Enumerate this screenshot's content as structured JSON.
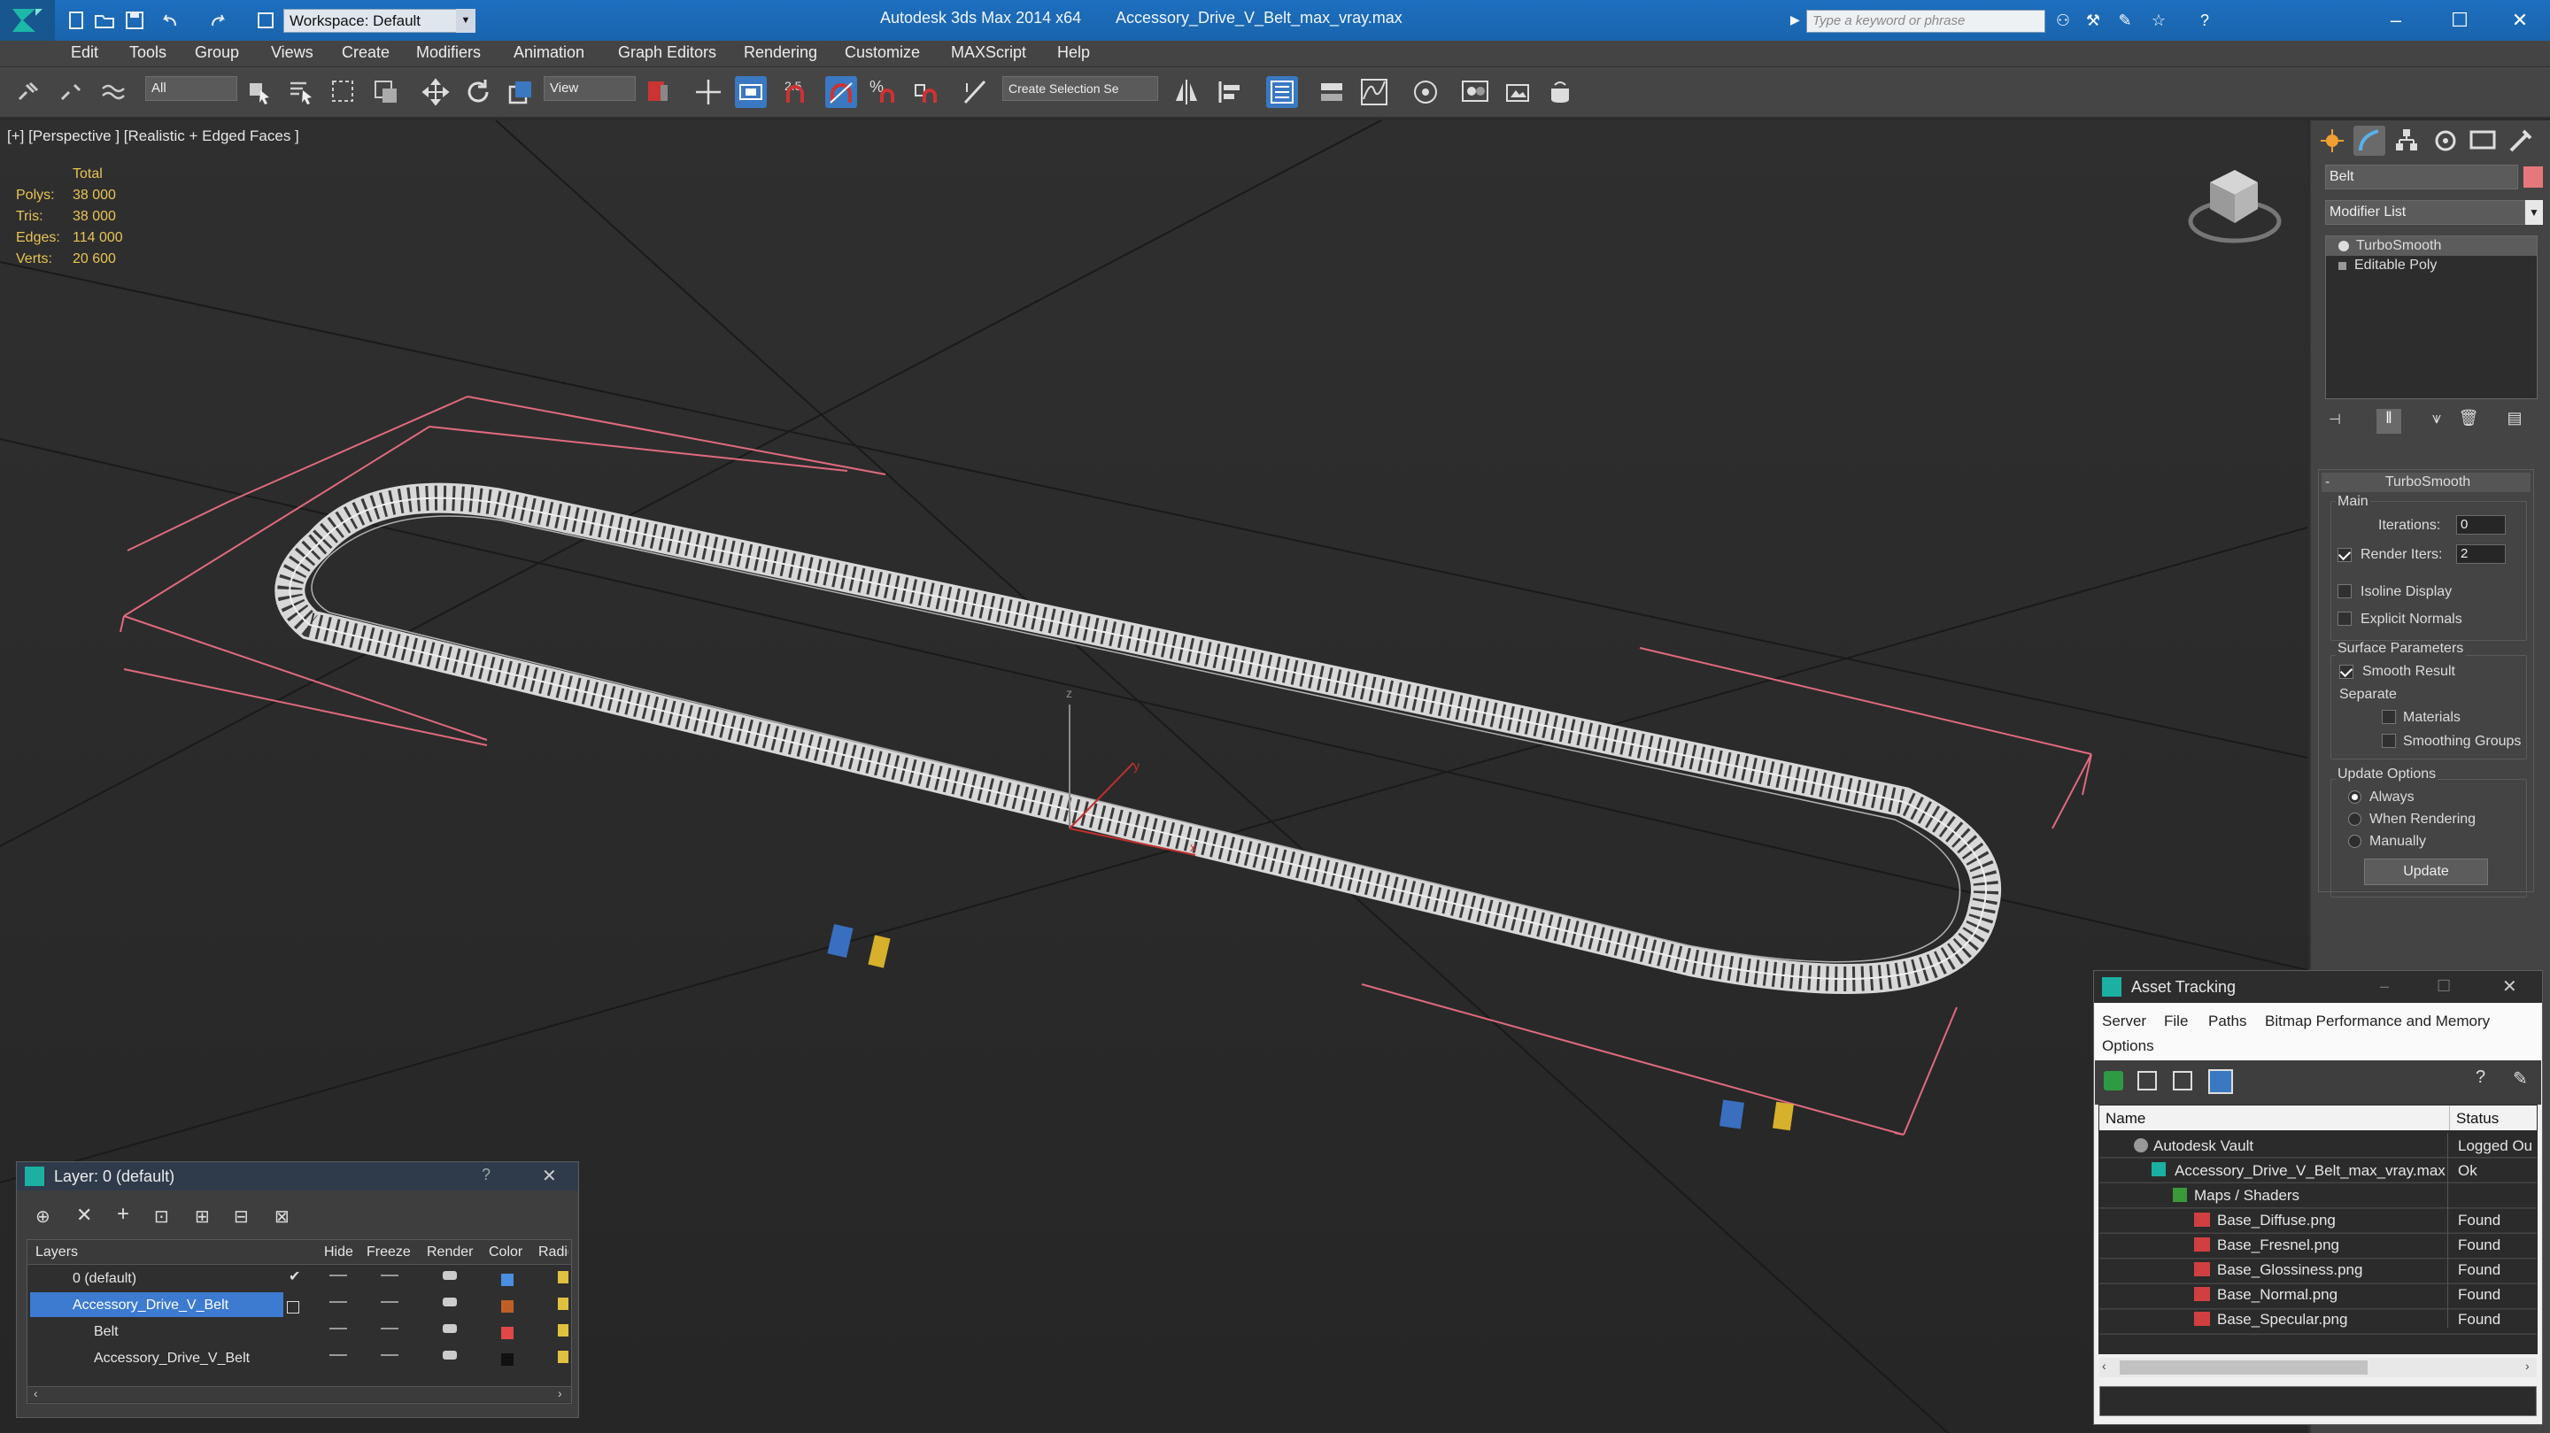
{
  "app": {
    "title": "Autodesk 3ds Max  2014 x64",
    "file": "Accessory_Drive_V_Belt_max_vray.max",
    "workspace": "Workspace: Default",
    "search_placeholder": "Type a keyword or phrase"
  },
  "menus": [
    "Edit",
    "Tools",
    "Group",
    "Views",
    "Create",
    "Modifiers",
    "Animation",
    "Graph Editors",
    "Rendering",
    "Customize",
    "MAXScript",
    "Help"
  ],
  "toolbar": {
    "filter": "All",
    "refcoord": "View",
    "selection_set": "Create Selection Se",
    "snap_angle": "2.5"
  },
  "viewport": {
    "label": "[+] [Perspective ] [Realistic + Edged Faces ]",
    "stats": {
      "header": "Total",
      "rows": [
        {
          "label": "Polys:",
          "value": "38 000"
        },
        {
          "label": "Tris:",
          "value": "38 000"
        },
        {
          "label": "Edges:",
          "value": "114 000"
        },
        {
          "label": "Verts:",
          "value": "20 600"
        }
      ]
    },
    "axis_z": "z",
    "axis_y": "y",
    "axis_x": "x"
  },
  "command_panel": {
    "object_name": "Belt",
    "object_color": "#e5787a",
    "modifier_list": "Modifier List",
    "stack": [
      "TurboSmooth",
      "Editable Poly"
    ],
    "rollout": {
      "title": "TurboSmooth",
      "main": "Main",
      "iterations_label": "Iterations:",
      "iterations": "0",
      "render_iters_label": "Render Iters:",
      "render_iters": "2",
      "isoline": "Isoline Display",
      "explicit": "Explicit Normals",
      "surface": "Surface Parameters",
      "smooth_result": "Smooth Result",
      "separate": "Separate",
      "materials": "Materials",
      "smoothing_groups": "Smoothing Groups",
      "update_options": "Update Options",
      "always": "Always",
      "when_rendering": "When Rendering",
      "manually": "Manually",
      "update": "Update"
    }
  },
  "layer_panel": {
    "title": "Layer: 0 (default)",
    "columns": [
      "Layers",
      "Hide",
      "Freeze",
      "Render",
      "Color",
      "Radio"
    ],
    "rows": [
      {
        "name": "0 (default)",
        "color": "#4a8fe0",
        "selected": false
      },
      {
        "name": "Accessory_Drive_V_Belt",
        "color": "#c06028",
        "selected": true
      },
      {
        "name": "Belt",
        "color": "#e04848",
        "selected": false
      },
      {
        "name": "Accessory_Drive_V_Belt",
        "color": "#111111",
        "selected": false
      }
    ]
  },
  "asset_tracking": {
    "title": "Asset Tracking",
    "menus": [
      "Server",
      "File",
      "Paths",
      "Bitmap Performance and Memory"
    ],
    "options": "Options",
    "columns": [
      "Name",
      "Status"
    ],
    "rows": [
      {
        "name": "Autodesk Vault",
        "status": "Logged Ou"
      },
      {
        "name": "Accessory_Drive_V_Belt_max_vray.max",
        "status": "Ok"
      },
      {
        "name": "Maps / Shaders",
        "status": ""
      },
      {
        "name": "Base_Diffuse.png",
        "status": "Found"
      },
      {
        "name": "Base_Fresnel.png",
        "status": "Found"
      },
      {
        "name": "Base_Glossiness.png",
        "status": "Found"
      },
      {
        "name": "Base_Normal.png",
        "status": "Found"
      },
      {
        "name": "Base_Specular.png",
        "status": "Found"
      }
    ]
  }
}
